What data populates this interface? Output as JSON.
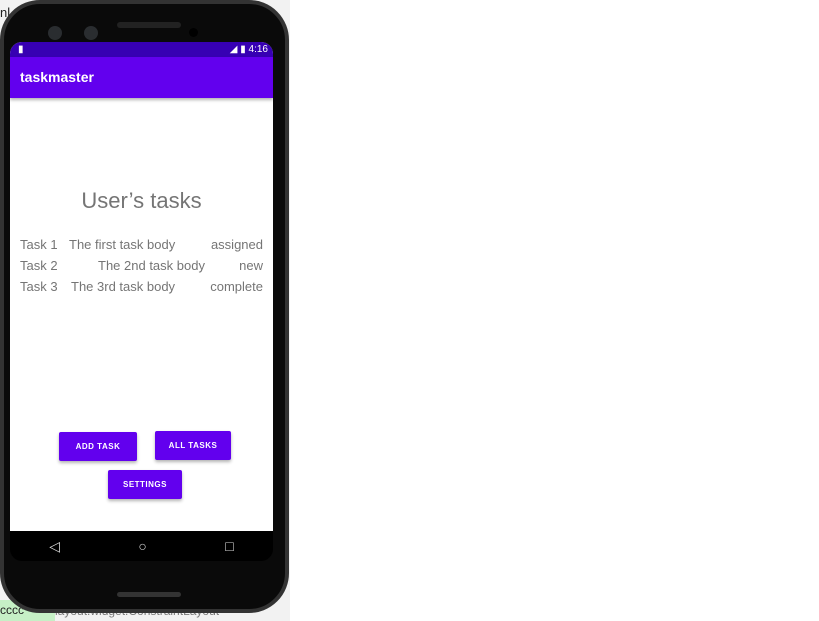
{
  "background": {
    "top_text": "nl",
    "bottom_left_text": "cccc",
    "bottom_text": "layout.widget.ConstraintLayout"
  },
  "status_bar": {
    "time": "4:16",
    "icons": [
      "sd-card-icon",
      "signal-icon",
      "battery-icon"
    ]
  },
  "app_bar": {
    "title": "taskmaster"
  },
  "main": {
    "heading": "User’s tasks",
    "tasks": [
      {
        "title": "Task 1",
        "body": "The first task body",
        "state": "assigned"
      },
      {
        "title": "Task 2",
        "body": "The 2nd task body",
        "state": "new"
      },
      {
        "title": "Task 3",
        "body": "The 3rd task body",
        "state": "complete"
      }
    ],
    "buttons": {
      "add_task": "ADD TASK",
      "all_tasks": "ALL TASKS",
      "settings": "SETTINGS"
    }
  },
  "nav_bar": {
    "icons": [
      "back-icon",
      "home-icon",
      "recents-icon"
    ]
  },
  "colors": {
    "primary": "#6200ee",
    "primary_dark": "#3700b3",
    "text": "#757575"
  }
}
